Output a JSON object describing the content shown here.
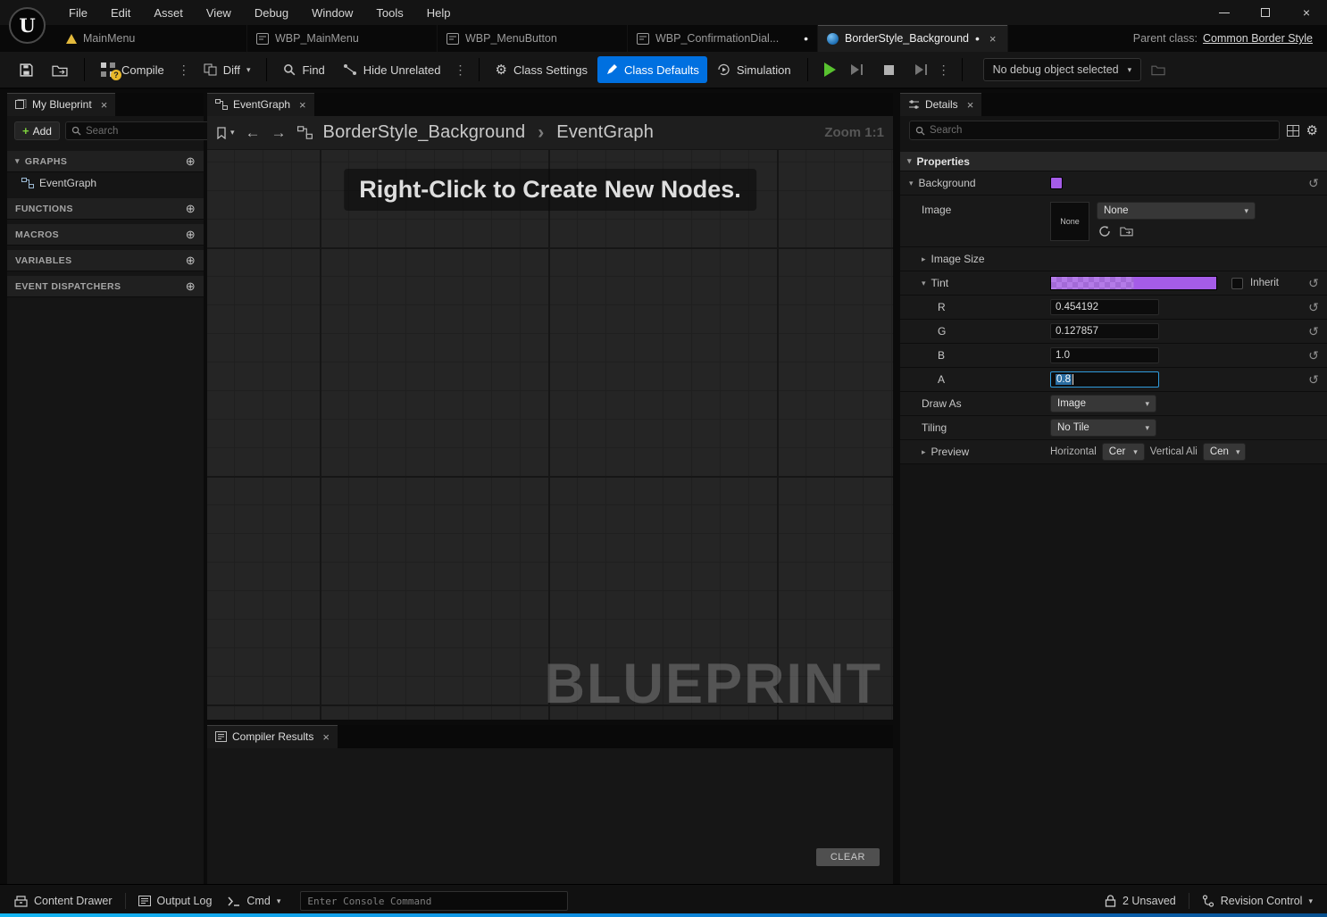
{
  "icons": {
    "logo": "U",
    "close": "×",
    "chevron_down": "▾",
    "caret_down": "▼",
    "caret_right": "▸",
    "plus_circle": "⊕",
    "plus": "+",
    "gear": "⚙",
    "reset": "↺",
    "back": "←",
    "forward": "→",
    "breadcrumb_chevron": "›",
    "menu_dots": "⋮",
    "dirty_dot": "•",
    "question": "?"
  },
  "menu": {
    "items": [
      "File",
      "Edit",
      "Asset",
      "View",
      "Debug",
      "Window",
      "Tools",
      "Help"
    ]
  },
  "asset_tabs": {
    "items": [
      {
        "label": "MainMenu"
      },
      {
        "label": "WBP_MainMenu"
      },
      {
        "label": "WBP_MenuButton"
      },
      {
        "label": "WBP_ConfirmationDial..."
      },
      {
        "label": "BorderStyle_Background"
      }
    ],
    "parent_class_label": "Parent class:",
    "parent_class_value": "Common Border Style"
  },
  "toolbar": {
    "compile": "Compile",
    "diff": "Diff",
    "find": "Find",
    "hide_unrelated": "Hide Unrelated",
    "class_settings": "Class Settings",
    "class_defaults": "Class Defaults",
    "simulation": "Simulation",
    "debug_select": "No debug object selected"
  },
  "my_blueprint": {
    "tab": "My Blueprint",
    "add": "Add",
    "search_placeholder": "Search",
    "sections": [
      "GRAPHS",
      "FUNCTIONS",
      "MACROS",
      "VARIABLES",
      "EVENT DISPATCHERS"
    ],
    "eventgraph_item": "EventGraph"
  },
  "graph": {
    "tab": "EventGraph",
    "breadcrumb_root": "BorderStyle_Background",
    "breadcrumb_leaf": "EventGraph",
    "zoom": "Zoom 1:1",
    "hint": "Right-Click to Create New Nodes.",
    "watermark": "BLUEPRINT"
  },
  "compiler": {
    "tab": "Compiler Results",
    "clear": "CLEAR"
  },
  "details": {
    "tab": "Details",
    "search_placeholder": "Search",
    "category": "Properties",
    "background_label": "Background",
    "image_label": "Image",
    "image_thumb": "None",
    "image_value": "None",
    "image_size_label": "Image Size",
    "tint_label": "Tint",
    "inherit_label": "Inherit",
    "channels": [
      {
        "label": "R",
        "value": "0.454192"
      },
      {
        "label": "G",
        "value": "0.127857"
      },
      {
        "label": "B",
        "value": "1.0"
      },
      {
        "label": "A",
        "value": "0.8"
      }
    ],
    "draw_as_label": "Draw As",
    "draw_as_value": "Image",
    "tiling_label": "Tiling",
    "tiling_value": "No Tile",
    "preview_label": "Preview",
    "horizontal_label": "Horizontal",
    "horizontal_value": "Cer",
    "vertical_label": "Vertical Ali",
    "vertical_value": "Cen"
  },
  "status_bar": {
    "content_drawer": "Content Drawer",
    "output_log": "Output Log",
    "cmd": "Cmd",
    "console_placeholder": "Enter Console Command",
    "unsaved": "2 Unsaved",
    "revision": "Revision Control"
  },
  "colors": {
    "accent_blue": "#0070e0",
    "tint_purple": "#a55ce8",
    "play_green": "#58c22f",
    "bottom_bar_blue": "#18a7e8"
  }
}
